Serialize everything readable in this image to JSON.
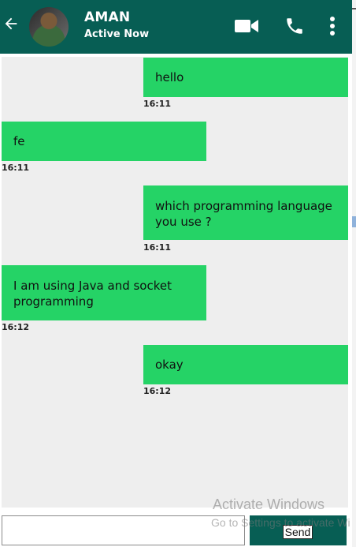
{
  "header": {
    "title": "AMAN",
    "status": "Active Now",
    "icons": [
      "back-arrow-icon",
      "video-call-icon",
      "phone-call-icon",
      "more-options-icon"
    ],
    "color": "#075e54"
  },
  "messages": [
    {
      "text": "hello",
      "time": "16:11",
      "side": "right"
    },
    {
      "text": "fe",
      "time": "16:11",
      "side": "left"
    },
    {
      "text": "which programming language you use ?",
      "time": "16:11",
      "side": "right"
    },
    {
      "text": "I am using Java and socket programming",
      "time": "16:12",
      "side": "left"
    },
    {
      "text": "okay",
      "time": "16:12",
      "side": "right"
    }
  ],
  "composer": {
    "input_value": "",
    "send_label": "Send"
  },
  "watermark": {
    "line1": "Activate Windows",
    "line2": "Go to Settings to activate Wi"
  },
  "colors": {
    "bubble": "#25d366",
    "chat_bg": "#eeeeee"
  }
}
